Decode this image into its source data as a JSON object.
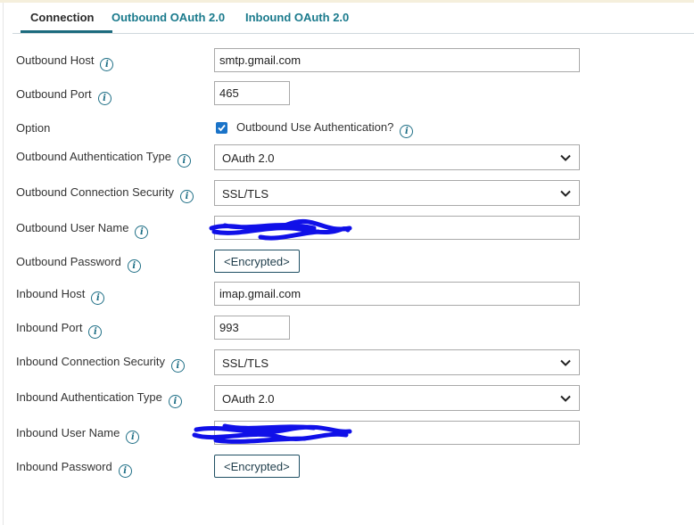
{
  "tabs": [
    {
      "label": "Connection",
      "active": true
    },
    {
      "label": "Outbound OAuth 2.0",
      "active": false
    },
    {
      "label": "Inbound OAuth 2.0",
      "active": false
    }
  ],
  "info_glyph": "i",
  "fields": {
    "outbound_host": {
      "label": "Outbound Host",
      "value": "smtp.gmail.com"
    },
    "outbound_port": {
      "label": "Outbound Port",
      "value": "465"
    },
    "option": {
      "label": "Option",
      "checkbox_label": "Outbound Use Authentication?",
      "checked": true
    },
    "outbound_auth_type": {
      "label": "Outbound Authentication Type",
      "value": "OAuth 2.0"
    },
    "outbound_conn_security": {
      "label": "Outbound Connection Security",
      "value": "SSL/TLS"
    },
    "outbound_user_name": {
      "label": "Outbound User Name",
      "value": ""
    },
    "outbound_password": {
      "label": "Outbound Password",
      "button": "<Encrypted>"
    },
    "inbound_host": {
      "label": "Inbound Host",
      "value": "imap.gmail.com"
    },
    "inbound_port": {
      "label": "Inbound Port",
      "value": "993"
    },
    "inbound_conn_security": {
      "label": "Inbound Connection Security",
      "value": "SSL/TLS"
    },
    "inbound_auth_type": {
      "label": "Inbound Authentication Type",
      "value": "OAuth 2.0"
    },
    "inbound_user_name": {
      "label": "Inbound User Name",
      "value": ""
    },
    "inbound_password": {
      "label": "Inbound Password",
      "button": "<Encrypted>"
    }
  },
  "colors": {
    "accent": "#1c6b7e",
    "tab_inactive": "#1a7a8c",
    "checkbox": "#1a73c8",
    "redaction": "#1010e8"
  }
}
